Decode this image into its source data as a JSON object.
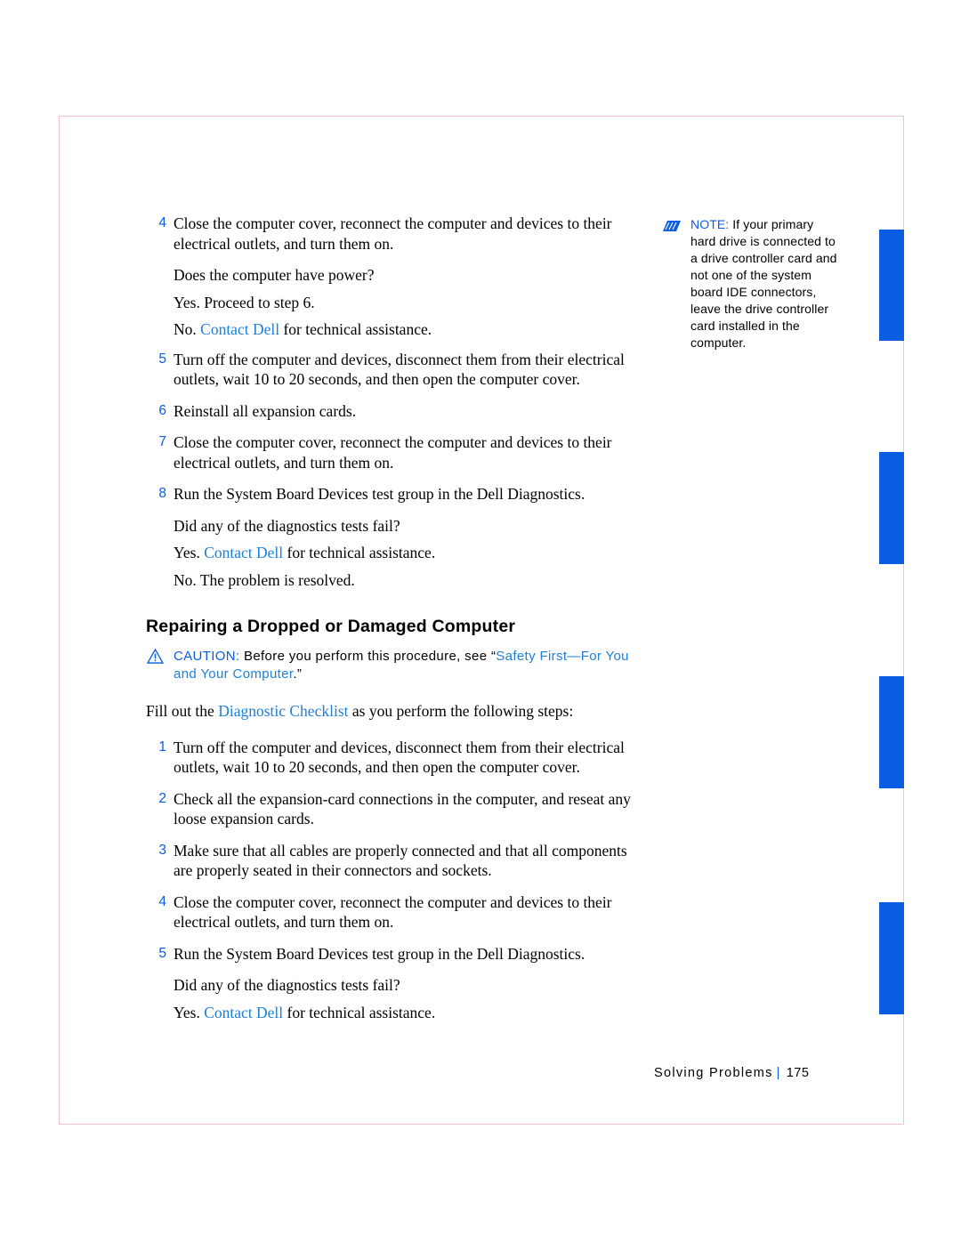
{
  "page": {
    "footer_section": "Solving Problems",
    "footer_separator": "|",
    "page_number": "175"
  },
  "note": {
    "label": "NOTE:",
    "text": " If your primary hard drive is connected to a drive controller card and not one of the system board IDE connectors, leave the drive controller card installed in the computer."
  },
  "steps_top": [
    {
      "num": "4",
      "text": "Close the computer cover, reconnect the computer and devices to their electrical outlets, and turn them on."
    },
    {
      "num": "5",
      "text": "Turn off the computer and devices, disconnect them from their electrical outlets, wait 10 to 20 seconds, and then open the computer cover."
    },
    {
      "num": "6",
      "text": "Reinstall all expansion cards."
    },
    {
      "num": "7",
      "text": "Close the computer cover, reconnect the computer and devices to their electrical outlets, and turn them on."
    },
    {
      "num": "8",
      "text": "Run the System Board Devices test group in the Dell Diagnostics."
    }
  ],
  "sub_after_4": {
    "question": "Does the computer have power?",
    "yes": "Yes. Proceed to step 6.",
    "no_prefix": "No. ",
    "no_link": "Contact Dell",
    "no_suffix": " for technical assistance."
  },
  "sub_after_8": {
    "question": "Did any of the diagnostics tests fail?",
    "yes_prefix": "Yes. ",
    "yes_link": "Contact Dell",
    "yes_suffix": " for technical assistance.",
    "no": "No. The problem is resolved."
  },
  "section": {
    "heading": "Repairing a Dropped or Damaged Computer",
    "caution_label": "CAUTION:",
    "caution_body_before": " Before you perform this procedure, see “",
    "caution_link": "Safety First—For You and Your Computer",
    "caution_body_after": ".”",
    "intro_before": "Fill out the ",
    "intro_link": "Diagnostic Checklist",
    "intro_after": " as you perform the following steps:"
  },
  "steps_bottom": [
    {
      "num": "1",
      "text": "Turn off the computer and devices, disconnect them from their electrical outlets, wait 10 to 20 seconds, and then open the computer cover."
    },
    {
      "num": "2",
      "text": "Check all the expansion-card connections in the computer, and reseat any loose expansion cards."
    },
    {
      "num": "3",
      "text": "Make sure that all cables are properly connected and that all components are properly seated in their connectors and sockets."
    },
    {
      "num": "4",
      "text": "Close the computer cover, reconnect the computer and devices to their electrical outlets, and turn them on."
    },
    {
      "num": "5",
      "text": "Run the System Board Devices test group in the Dell Diagnostics."
    }
  ],
  "sub_bottom": {
    "question": "Did any of the diagnostics tests fail?",
    "yes_prefix": "Yes. ",
    "yes_link": "Contact Dell",
    "yes_suffix": " for technical assistance."
  },
  "colors": {
    "accent_blue": "#0a5ce0",
    "link_blue": "#1d7fd8",
    "frame_pink": "#f2c6c6"
  }
}
